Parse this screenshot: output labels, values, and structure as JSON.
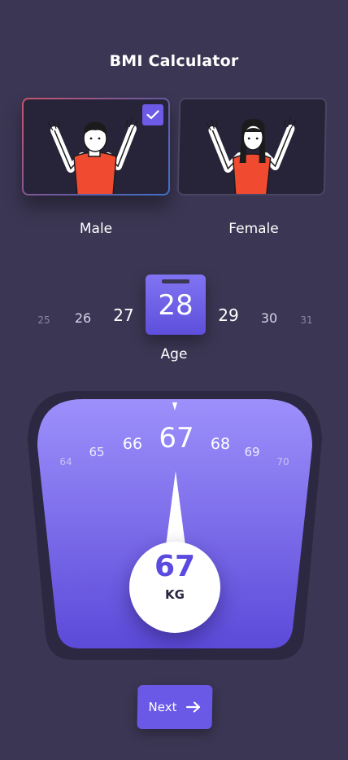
{
  "app": {
    "title": "BMI Calculator"
  },
  "gender": {
    "options": [
      {
        "label": "Male",
        "selected": true,
        "icon": "male-avatar"
      },
      {
        "label": "Female",
        "selected": false,
        "icon": "female-avatar"
      }
    ],
    "check_icon": "check-icon"
  },
  "age": {
    "values": [
      "25",
      "26",
      "27",
      "28",
      "29",
      "30",
      "31"
    ],
    "selected": "28",
    "label": "Age"
  },
  "weight": {
    "ticks": [
      "64",
      "65",
      "66",
      "67",
      "68",
      "69",
      "70"
    ],
    "selected": "67",
    "value": "67",
    "unit": "KG"
  },
  "next": {
    "label": "Next",
    "icon": "arrow-right-icon"
  },
  "colors": {
    "background": "#3b3653",
    "accent": "#6a58e6",
    "card": "#272439",
    "scale_top": "#9d90fb",
    "scale_bottom": "#5c4ad9"
  }
}
